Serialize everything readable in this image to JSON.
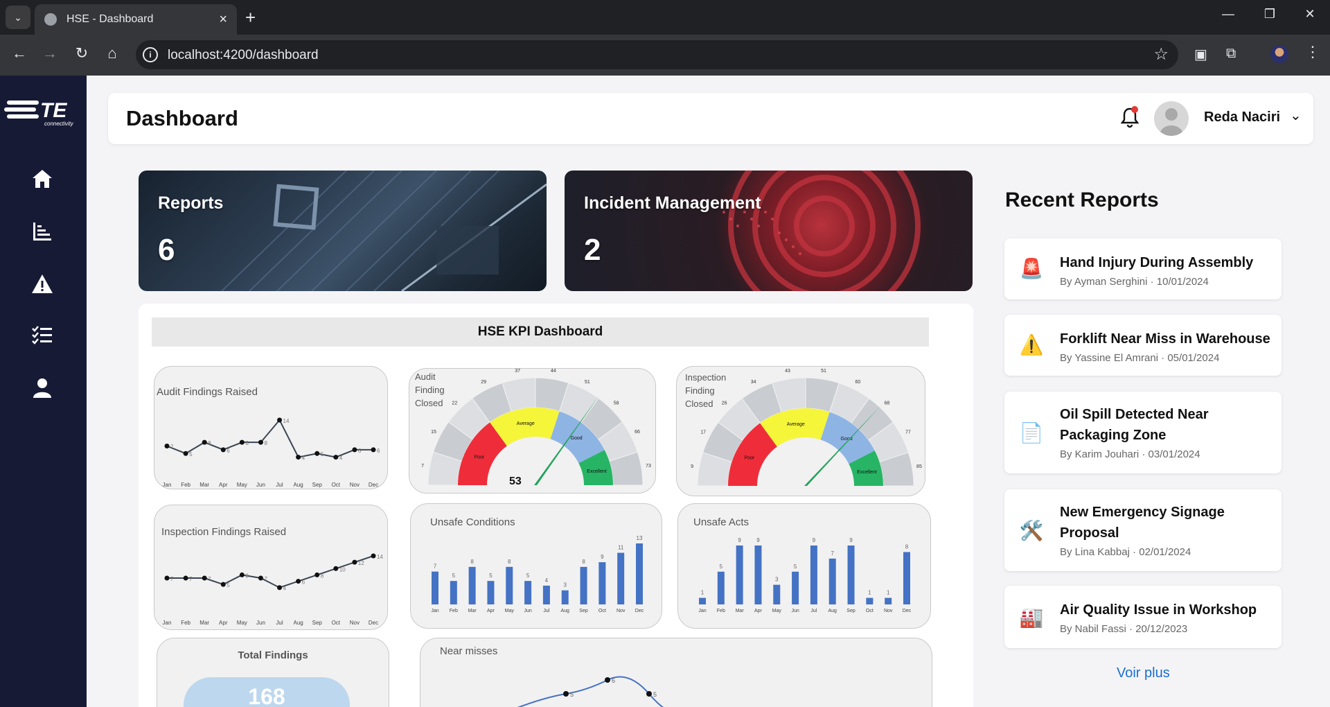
{
  "browser": {
    "tab_title": "HSE - Dashboard",
    "url": "localhost:4200/dashboard",
    "new_tab": "+",
    "minimize": "—",
    "restore": "❐",
    "close": "✕"
  },
  "sidebar": {
    "logo_text": "TE",
    "logo_sub": "connectivity",
    "items": [
      "home-icon",
      "chart-bars-icon",
      "warning-icon",
      "checklist-icon",
      "user-icon"
    ]
  },
  "header": {
    "title": "Dashboard",
    "user_name": "Reda Naciri",
    "notification_dot_color": "#e53935"
  },
  "summary_cards": {
    "reports": {
      "label": "Reports",
      "value": "6"
    },
    "incidents": {
      "label": "Incident Management",
      "value": "2"
    }
  },
  "kpi": {
    "title": "HSE KPI Dashboard",
    "months": [
      "Jan",
      "Feb",
      "Mar",
      "Apr",
      "May",
      "Jun",
      "Jul",
      "Aug",
      "Sep",
      "Oct",
      "Nov",
      "Dec"
    ],
    "audit_findings_raised": {
      "label": "Audit Findings Raised",
      "values": [
        7,
        5,
        8,
        6,
        8,
        8,
        14,
        4,
        5,
        4,
        6,
        6
      ]
    },
    "audit_findings_closed": {
      "label_lines": [
        "Audit",
        "Finding",
        "Closed"
      ],
      "value": "53",
      "ticks": [
        "7",
        "15",
        "22",
        "29",
        "37",
        "44",
        "51",
        "58",
        "66",
        "73"
      ],
      "bands": [
        "Poor",
        "Average",
        "Good",
        "Excellent"
      ]
    },
    "inspection_findings_closed": {
      "label_lines": [
        "Inspection",
        "Finding",
        "Closed"
      ],
      "ticks": [
        "9",
        "17",
        "26",
        "34",
        "43",
        "51",
        "60",
        "68",
        "77",
        "85"
      ],
      "bands": [
        "Poor",
        "Average",
        "Good",
        "Excellent"
      ]
    },
    "inspection_findings_raised": {
      "label": "Inspection Findings Raised",
      "values": [
        7,
        7,
        7,
        5,
        8,
        7,
        4,
        6,
        8,
        10,
        12,
        14
      ]
    },
    "unsafe_conditions": {
      "label": "Unsafe Conditions",
      "values": [
        7,
        5,
        8,
        5,
        8,
        5,
        4,
        3,
        8,
        9,
        11,
        13
      ]
    },
    "unsafe_acts": {
      "label": "Unsafe Acts",
      "values": [
        1,
        5,
        9,
        9,
        3,
        5,
        9,
        7,
        9,
        1,
        1,
        8
      ]
    },
    "total_findings": {
      "label": "Total Findings",
      "value": "168"
    },
    "near_misses": {
      "label": "Near misses",
      "visible_labels": [
        "5",
        "6",
        "5"
      ]
    }
  },
  "recent_reports": {
    "title": "Recent Reports",
    "items": [
      {
        "title": "Hand Injury During Assembly",
        "meta": "By Ayman Serghini · 10/01/2024",
        "icon": "🚨"
      },
      {
        "title": "Forklift Near Miss in Warehouse",
        "meta": "By Yassine El Amrani · 05/01/2024",
        "icon": "⚠️"
      },
      {
        "title": "Oil Spill Detected Near Packaging Zone",
        "meta": "By Karim Jouhari · 03/01/2024",
        "icon": "📄"
      },
      {
        "title": "New Emergency Signage Proposal",
        "meta": "By Lina Kabbaj · 02/01/2024",
        "icon": "🛠️"
      },
      {
        "title": "Air Quality Issue in Workshop",
        "meta": "By Nabil Fassi · 20/12/2023",
        "icon": "🏭"
      }
    ],
    "more_link": "Voir plus"
  }
}
